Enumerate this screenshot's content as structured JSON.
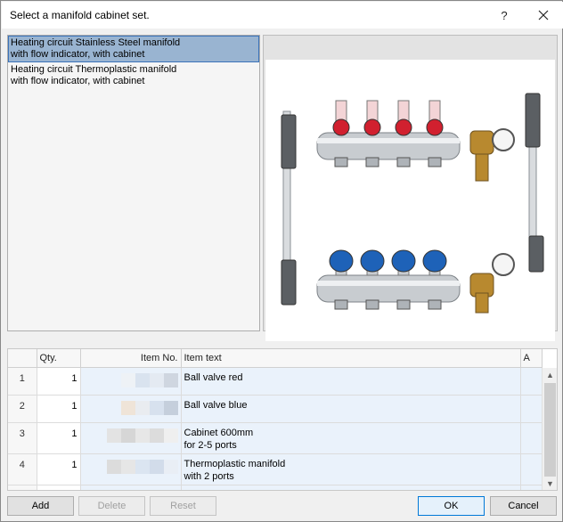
{
  "window": {
    "title": "Select a manifold cabinet set.",
    "help_glyph": "?",
    "close_glyph": "✕"
  },
  "sets": [
    {
      "label": "Heating circuit Stainless Steel manifold\nwith flow indicator, with cabinet",
      "selected": true
    },
    {
      "label": "Heating circuit Thermoplastic manifold\nwith flow indicator, with cabinet",
      "selected": false
    }
  ],
  "preview": {
    "image": "manifold-cabinet-set-image",
    "colors": {
      "upper_caps": "#d1202f",
      "lower_caps": "#1e62b8",
      "metal": "#c8ccd0",
      "brass": "#b8892f"
    }
  },
  "grid": {
    "columns": [
      "",
      "Qty.",
      "Item No.",
      "Item text",
      "A"
    ],
    "rows": [
      {
        "num": "1",
        "qty": "1",
        "text": "Ball valve red"
      },
      {
        "num": "2",
        "qty": "1",
        "text": "Ball valve blue"
      },
      {
        "num": "3",
        "qty": "1",
        "text": "Cabinet 600mm\nfor 2-5 ports"
      },
      {
        "num": "4",
        "qty": "1",
        "text": "Thermoplastic manifold\nwith 2 ports"
      }
    ],
    "scroll_up": "▲",
    "scroll_down": "▼"
  },
  "buttons": {
    "add": "Add",
    "delete": "Delete",
    "reset": "Reset",
    "ok": "OK",
    "cancel": "Cancel"
  }
}
